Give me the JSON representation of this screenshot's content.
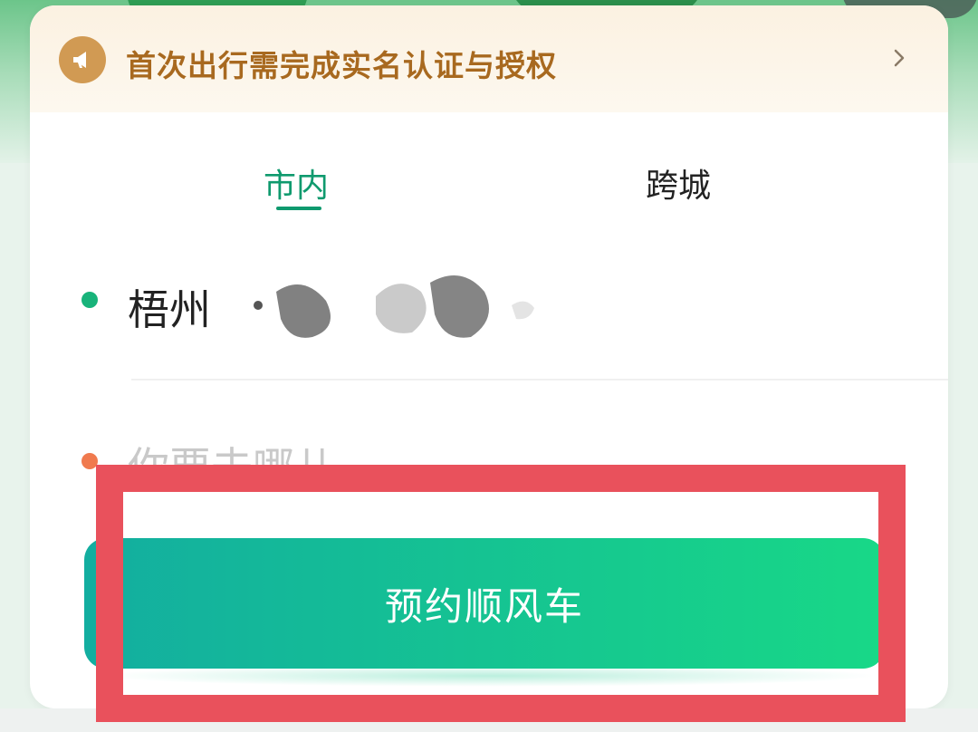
{
  "notice": {
    "icon": "megaphone-icon",
    "text": "首次出行需完成实名认证与授权",
    "chevron": "chevron-right-icon",
    "color": "#a8691f"
  },
  "tabs": [
    {
      "label": "市内",
      "active": true
    },
    {
      "label": "跨城",
      "active": false
    }
  ],
  "route": {
    "origin_city": "梧州",
    "destination_placeholder": "你要去哪儿"
  },
  "primary_button": {
    "label": "预约顺风车"
  },
  "colors": {
    "accent": "#0f9a6e",
    "origin_dot": "#18b37a",
    "destination_dot": "#f07a4e",
    "highlight_box": "#e9515c"
  }
}
